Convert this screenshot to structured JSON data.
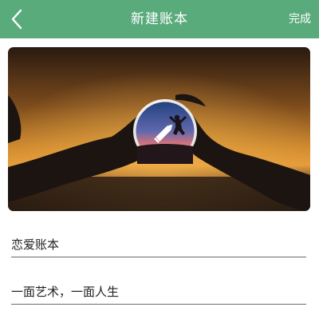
{
  "header": {
    "title": "新建账本",
    "done_label": "完成",
    "back_icon": "chevron-left-icon",
    "color": "#5aab7c"
  },
  "cover": {
    "avatar_icon": "pencil-icon",
    "edit_overlay": true
  },
  "form": {
    "book_name": "恋爱账本",
    "book_description": "一面艺术，一面人生"
  }
}
